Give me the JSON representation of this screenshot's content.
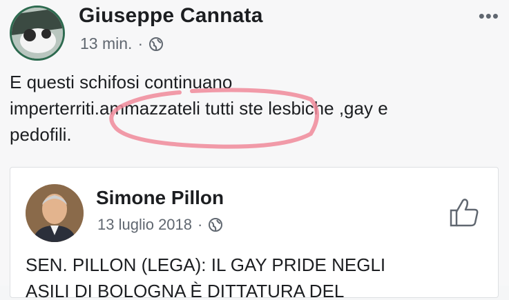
{
  "post": {
    "author": "Giuseppe Cannata",
    "time": "13 min.",
    "separator": "·",
    "privacy_icon": "globe-icon",
    "more_icon": "more-options-icon",
    "text_lines": [
      "E questi schifosi continuano",
      "imperterriti.ammazzateli tutti ste lesbiche ,gay e",
      "pedofili."
    ]
  },
  "shared_post": {
    "author": "Simone Pillon",
    "date": "13 luglio 2018",
    "separator": "·",
    "privacy_icon": "globe-icon",
    "like_icon": "thumbs-up-icon",
    "text_lines": [
      "SEN. PILLON (LEGA): IL GAY PRIDE NEGLI",
      "ASILI DI BOLOGNA È DITTATURA DEL"
    ]
  },
  "colors": {
    "highlight": "#f08a9a",
    "meta": "#606770",
    "text": "#1c1e21"
  }
}
